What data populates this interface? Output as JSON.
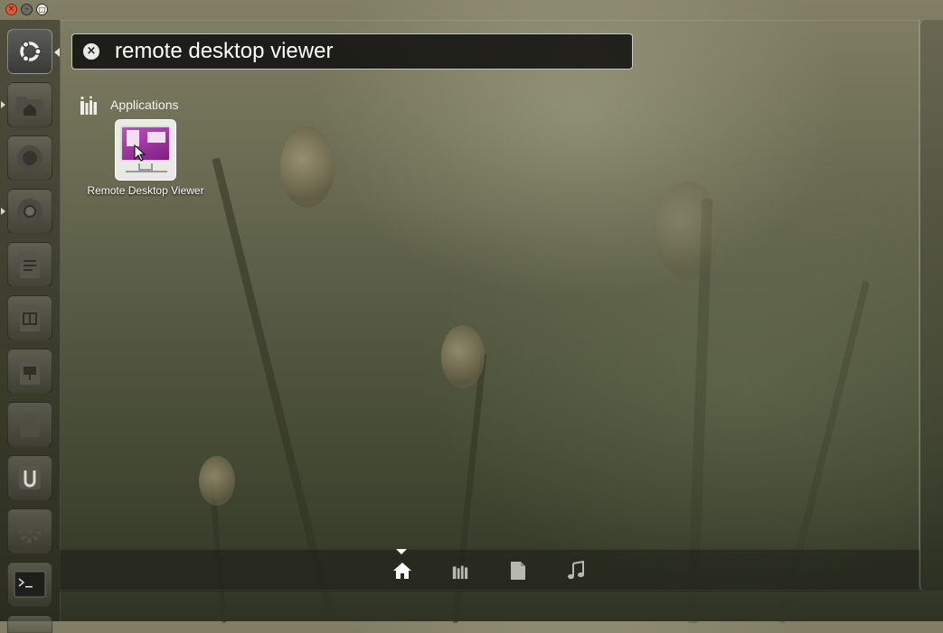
{
  "window_controls": {
    "close": "close-icon",
    "minimize": "minimize-icon",
    "maximize": "maximize-icon"
  },
  "launcher": {
    "items": [
      {
        "name": "dash-home",
        "icon": "ubuntu-logo-icon"
      },
      {
        "name": "home-folder",
        "icon": "folder-home-icon"
      },
      {
        "name": "firefox",
        "icon": "firefox-icon"
      },
      {
        "name": "chromium",
        "icon": "chromium-icon"
      },
      {
        "name": "libreoffice-writer",
        "icon": "writer-icon"
      },
      {
        "name": "libreoffice-calc",
        "icon": "calc-icon"
      },
      {
        "name": "libreoffice-impress",
        "icon": "impress-icon"
      },
      {
        "name": "software-center",
        "icon": "shopping-bag-icon"
      },
      {
        "name": "ubuntu-one",
        "icon": "ubuntu-one-icon"
      },
      {
        "name": "system-settings",
        "icon": "gear-wrench-icon"
      },
      {
        "name": "terminal",
        "icon": "terminal-icon"
      }
    ]
  },
  "search": {
    "query": "remote desktop viewer",
    "clear_icon": "clear-icon"
  },
  "results": {
    "category": "Applications",
    "category_icon": "applications-icon",
    "items": [
      {
        "label": "Remote Desktop Viewer",
        "icon": "remote-desktop-icon"
      }
    ]
  },
  "lens_bar": {
    "lenses": [
      {
        "name": "home",
        "icon": "home-icon",
        "active": true
      },
      {
        "name": "applications",
        "icon": "applications-icon",
        "active": false
      },
      {
        "name": "files",
        "icon": "file-icon",
        "active": false
      },
      {
        "name": "music",
        "icon": "music-note-icon",
        "active": false
      }
    ]
  }
}
